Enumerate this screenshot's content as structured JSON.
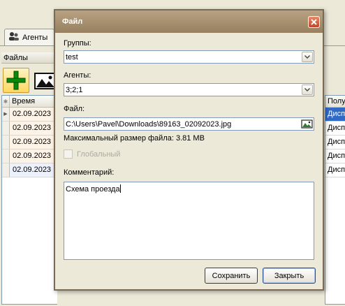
{
  "background": {
    "tab_label": "Агенты",
    "section_label": "Файлы",
    "grid": {
      "time_header": "Время",
      "right_header": "Полу",
      "rows": [
        {
          "date": "02.09.2023",
          "right": "Дисп",
          "tone": "orange",
          "right_sel": true
        },
        {
          "date": "02.09.2023",
          "right": "Дисп",
          "tone": "orange",
          "right_sel": false
        },
        {
          "date": "02.09.2023",
          "right": "Дисп",
          "tone": "orange",
          "right_sel": false
        },
        {
          "date": "02.09.2023",
          "right": "Дисп",
          "tone": "orange",
          "right_sel": false
        },
        {
          "date": "02.09.2023",
          "right": "Дисп",
          "tone": "blue",
          "right_sel": false
        }
      ]
    }
  },
  "dialog": {
    "title": "Файл",
    "groups_label": "Группы:",
    "groups_value": "test",
    "agents_label": "Агенты:",
    "agents_value": "3;2;1",
    "file_label": "Файл:",
    "file_value": "C:\\Users\\Pavel\\Downloads\\89163_02092023.jpg",
    "max_size_text": "Максимальный размер файла: 3.81 MB",
    "global_label": "Глобальный",
    "global_checked": false,
    "comment_label": "Комментарий:",
    "comment_value": "Схема проезда",
    "save_button": "Сохранить",
    "close_button": "Закрыть"
  },
  "colors": {
    "title_bar": "#98805f",
    "selection": "#3169c6",
    "close_button": "#c4432b",
    "add_button": "#ffd862"
  },
  "icons": {
    "tab": "agents-icon",
    "add": "plus-icon",
    "image": "image-icon",
    "close": "close-icon",
    "dropdown": "chevron-down-icon",
    "browse": "image-icon"
  }
}
